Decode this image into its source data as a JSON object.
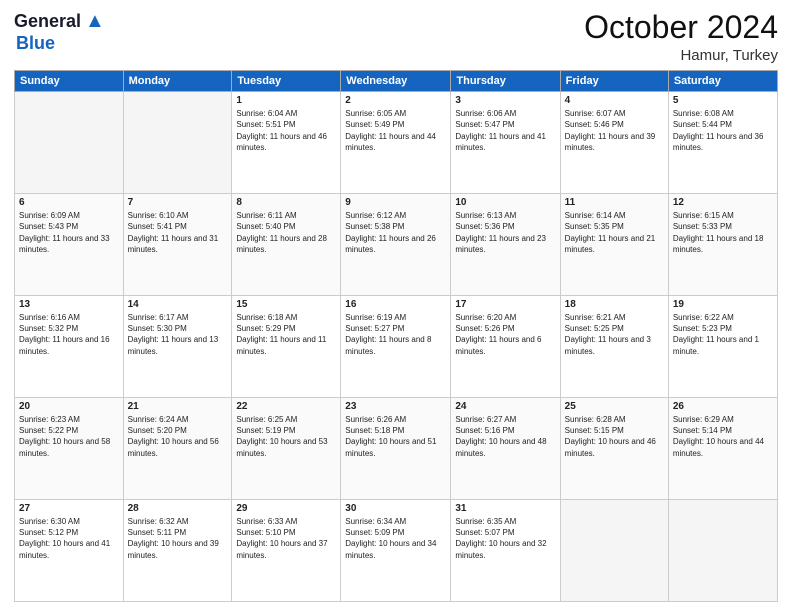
{
  "header": {
    "logo_general": "General",
    "logo_blue": "Blue",
    "month": "October 2024",
    "location": "Hamur, Turkey"
  },
  "weekdays": [
    "Sunday",
    "Monday",
    "Tuesday",
    "Wednesday",
    "Thursday",
    "Friday",
    "Saturday"
  ],
  "weeks": [
    [
      {
        "day": "",
        "info": ""
      },
      {
        "day": "",
        "info": ""
      },
      {
        "day": "1",
        "info": "Sunrise: 6:04 AM\nSunset: 5:51 PM\nDaylight: 11 hours and 46 minutes."
      },
      {
        "day": "2",
        "info": "Sunrise: 6:05 AM\nSunset: 5:49 PM\nDaylight: 11 hours and 44 minutes."
      },
      {
        "day": "3",
        "info": "Sunrise: 6:06 AM\nSunset: 5:47 PM\nDaylight: 11 hours and 41 minutes."
      },
      {
        "day": "4",
        "info": "Sunrise: 6:07 AM\nSunset: 5:46 PM\nDaylight: 11 hours and 39 minutes."
      },
      {
        "day": "5",
        "info": "Sunrise: 6:08 AM\nSunset: 5:44 PM\nDaylight: 11 hours and 36 minutes."
      }
    ],
    [
      {
        "day": "6",
        "info": "Sunrise: 6:09 AM\nSunset: 5:43 PM\nDaylight: 11 hours and 33 minutes."
      },
      {
        "day": "7",
        "info": "Sunrise: 6:10 AM\nSunset: 5:41 PM\nDaylight: 11 hours and 31 minutes."
      },
      {
        "day": "8",
        "info": "Sunrise: 6:11 AM\nSunset: 5:40 PM\nDaylight: 11 hours and 28 minutes."
      },
      {
        "day": "9",
        "info": "Sunrise: 6:12 AM\nSunset: 5:38 PM\nDaylight: 11 hours and 26 minutes."
      },
      {
        "day": "10",
        "info": "Sunrise: 6:13 AM\nSunset: 5:36 PM\nDaylight: 11 hours and 23 minutes."
      },
      {
        "day": "11",
        "info": "Sunrise: 6:14 AM\nSunset: 5:35 PM\nDaylight: 11 hours and 21 minutes."
      },
      {
        "day": "12",
        "info": "Sunrise: 6:15 AM\nSunset: 5:33 PM\nDaylight: 11 hours and 18 minutes."
      }
    ],
    [
      {
        "day": "13",
        "info": "Sunrise: 6:16 AM\nSunset: 5:32 PM\nDaylight: 11 hours and 16 minutes."
      },
      {
        "day": "14",
        "info": "Sunrise: 6:17 AM\nSunset: 5:30 PM\nDaylight: 11 hours and 13 minutes."
      },
      {
        "day": "15",
        "info": "Sunrise: 6:18 AM\nSunset: 5:29 PM\nDaylight: 11 hours and 11 minutes."
      },
      {
        "day": "16",
        "info": "Sunrise: 6:19 AM\nSunset: 5:27 PM\nDaylight: 11 hours and 8 minutes."
      },
      {
        "day": "17",
        "info": "Sunrise: 6:20 AM\nSunset: 5:26 PM\nDaylight: 11 hours and 6 minutes."
      },
      {
        "day": "18",
        "info": "Sunrise: 6:21 AM\nSunset: 5:25 PM\nDaylight: 11 hours and 3 minutes."
      },
      {
        "day": "19",
        "info": "Sunrise: 6:22 AM\nSunset: 5:23 PM\nDaylight: 11 hours and 1 minute."
      }
    ],
    [
      {
        "day": "20",
        "info": "Sunrise: 6:23 AM\nSunset: 5:22 PM\nDaylight: 10 hours and 58 minutes."
      },
      {
        "day": "21",
        "info": "Sunrise: 6:24 AM\nSunset: 5:20 PM\nDaylight: 10 hours and 56 minutes."
      },
      {
        "day": "22",
        "info": "Sunrise: 6:25 AM\nSunset: 5:19 PM\nDaylight: 10 hours and 53 minutes."
      },
      {
        "day": "23",
        "info": "Sunrise: 6:26 AM\nSunset: 5:18 PM\nDaylight: 10 hours and 51 minutes."
      },
      {
        "day": "24",
        "info": "Sunrise: 6:27 AM\nSunset: 5:16 PM\nDaylight: 10 hours and 48 minutes."
      },
      {
        "day": "25",
        "info": "Sunrise: 6:28 AM\nSunset: 5:15 PM\nDaylight: 10 hours and 46 minutes."
      },
      {
        "day": "26",
        "info": "Sunrise: 6:29 AM\nSunset: 5:14 PM\nDaylight: 10 hours and 44 minutes."
      }
    ],
    [
      {
        "day": "27",
        "info": "Sunrise: 6:30 AM\nSunset: 5:12 PM\nDaylight: 10 hours and 41 minutes."
      },
      {
        "day": "28",
        "info": "Sunrise: 6:32 AM\nSunset: 5:11 PM\nDaylight: 10 hours and 39 minutes."
      },
      {
        "day": "29",
        "info": "Sunrise: 6:33 AM\nSunset: 5:10 PM\nDaylight: 10 hours and 37 minutes."
      },
      {
        "day": "30",
        "info": "Sunrise: 6:34 AM\nSunset: 5:09 PM\nDaylight: 10 hours and 34 minutes."
      },
      {
        "day": "31",
        "info": "Sunrise: 6:35 AM\nSunset: 5:07 PM\nDaylight: 10 hours and 32 minutes."
      },
      {
        "day": "",
        "info": ""
      },
      {
        "day": "",
        "info": ""
      }
    ]
  ]
}
